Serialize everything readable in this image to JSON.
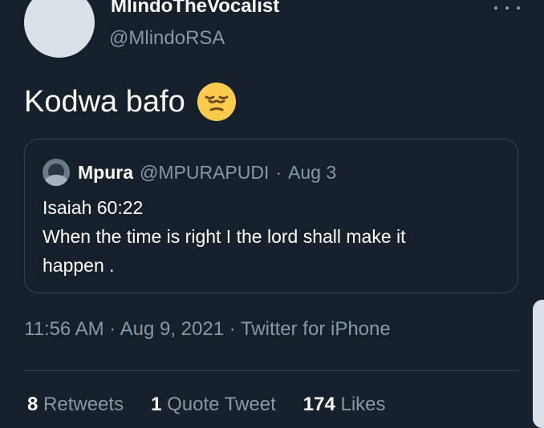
{
  "tweet": {
    "author": {
      "display_name": "MlindoTheVocalist",
      "handle": "@MlindoRSA"
    },
    "text": "Kodwa bafo",
    "emoji": "pensive-face-emoji",
    "quote": {
      "author_name": "Mpura",
      "author_handle": "@MPURAPUDI",
      "separator": "·",
      "date": "Aug 3",
      "body": "Isaiah 60:22\nWhen the time is right I the lord shall make it\nhappen ."
    },
    "timestamp": "11:56 AM · Aug 9, 2021 · Twitter for iPhone",
    "stats": {
      "retweets_count": "8",
      "retweets_label": "Retweets",
      "quote_count": "1",
      "quote_label": "Quote Tweet",
      "likes_count": "174",
      "likes_label": "Likes"
    }
  },
  "icons": {
    "more": "more-horizontal-icon"
  },
  "colors": {
    "background": "#15202b",
    "primary_text": "#ffffff",
    "secondary_text": "#8899a6",
    "border": "#38444d"
  }
}
